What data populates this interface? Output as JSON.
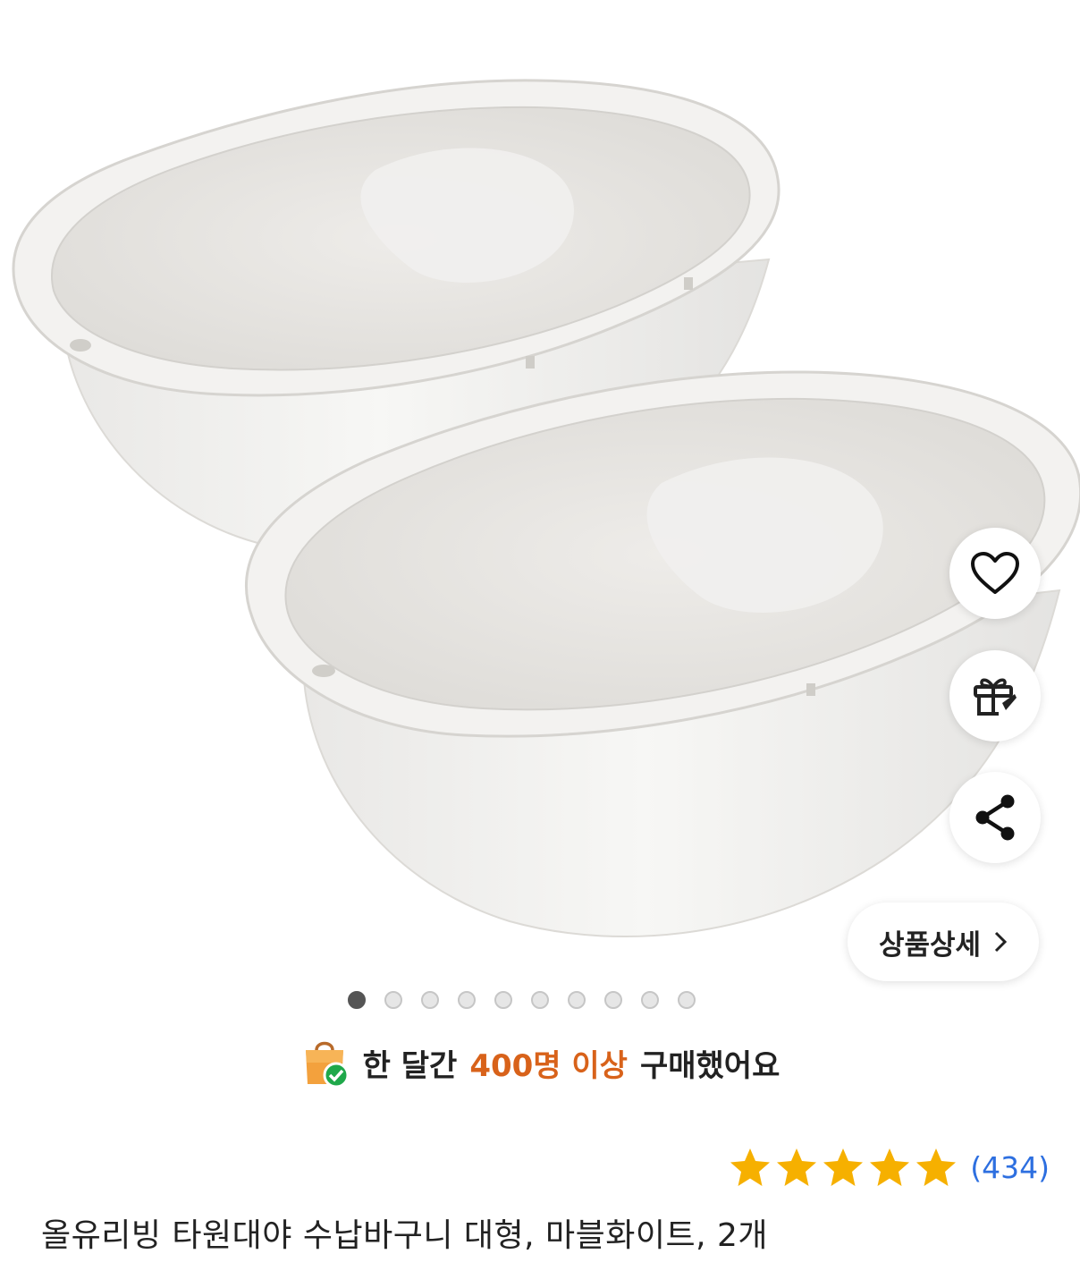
{
  "product": {
    "image_alt": "올유리빙 타원대야 수납바구니 대형, 마블화이트, 2개",
    "gallery": {
      "total": 10,
      "active_index": 0
    },
    "actions": {
      "wishlist": "heart-icon",
      "gift": "gift-icon",
      "share": "share-icon",
      "detail_label": "상품상세"
    },
    "social_proof": {
      "prefix": "한 달간",
      "highlight": "400명 이상",
      "suffix": "구매했어요",
      "highlight_color": "#d8621a"
    },
    "rating": {
      "stars": 5,
      "count_text": "(434)",
      "star_color": "#f6b000"
    },
    "title": "올유리빙 타원대야 수납바구니 대형, 마블화이트, 2개"
  }
}
